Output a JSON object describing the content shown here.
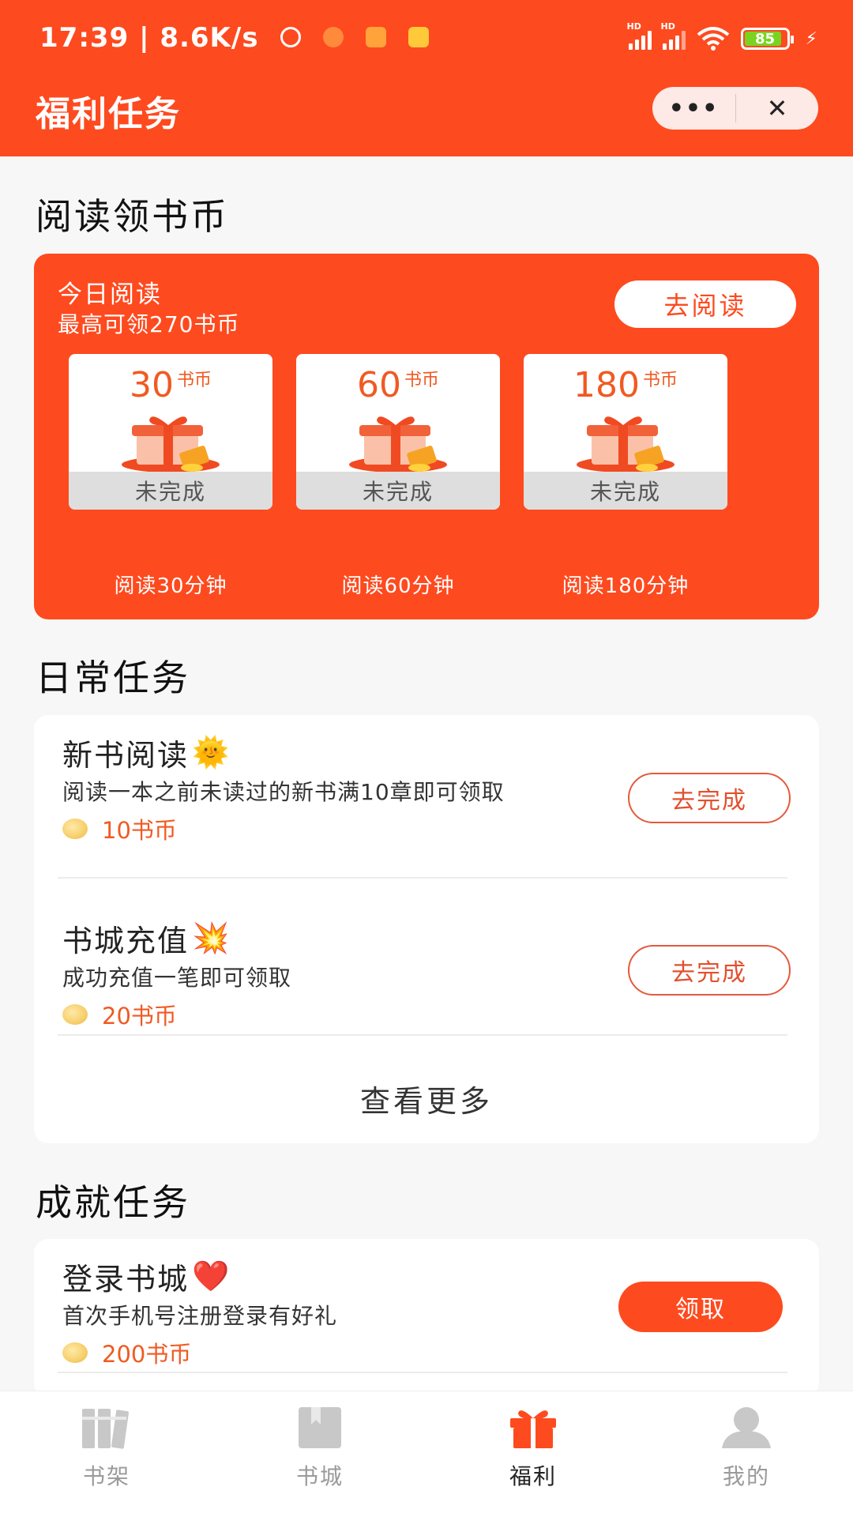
{
  "status_bar": {
    "time": "17:39",
    "speed": "8.6K/s",
    "battery": "85"
  },
  "header": {
    "title": "福利任务",
    "more_label": "•••",
    "close_label": "✕"
  },
  "reading": {
    "section_title": "阅读领书币",
    "card_title": "今日阅读",
    "card_subtitle": "最高可领270书币",
    "go_read_label": "去阅读",
    "rewards": [
      {
        "amount": "30",
        "unit": "书币",
        "status": "未完成",
        "label": "阅读30分钟"
      },
      {
        "amount": "60",
        "unit": "书币",
        "status": "未完成",
        "label": "阅读60分钟"
      },
      {
        "amount": "180",
        "unit": "书币",
        "status": "未完成",
        "label": "阅读180分钟"
      }
    ]
  },
  "daily": {
    "section_title": "日常任务",
    "tasks": [
      {
        "name": "新书阅读",
        "emoji": "🌞",
        "desc": "阅读一本之前未读过的新书满10章即可领取",
        "reward": "10书币",
        "button": "去完成"
      },
      {
        "name": "书城充值",
        "emoji": "💥",
        "desc": "成功充值一笔即可领取",
        "reward": "20书币",
        "button": "去完成"
      }
    ],
    "see_more": "查看更多"
  },
  "achievement": {
    "section_title": "成就任务",
    "tasks": [
      {
        "name": "登录书城",
        "emoji": "❤️",
        "desc": "首次手机号注册登录有好礼",
        "reward": "200书币",
        "button": "领取"
      }
    ]
  },
  "tabbar": {
    "tabs": [
      {
        "label": "书架",
        "icon": "bookshelf-icon"
      },
      {
        "label": "书城",
        "icon": "bookstore-icon"
      },
      {
        "label": "福利",
        "icon": "gift-icon"
      },
      {
        "label": "我的",
        "icon": "user-icon"
      }
    ],
    "active_index": 2
  },
  "colors": {
    "brand": "#fe4a1f",
    "reward_text": "#f05a22",
    "inactive_tab": "#9a9a9a"
  }
}
